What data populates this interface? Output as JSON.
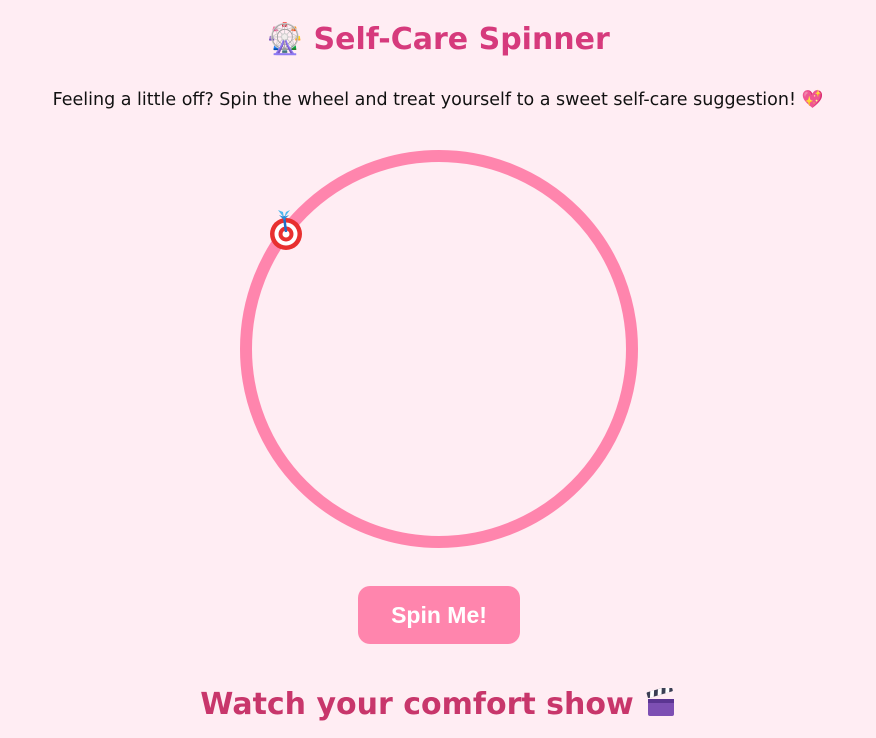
{
  "header": {
    "icon": "ferris-wheel-icon",
    "icon_glyph": "🎡",
    "title": "Self-Care Spinner"
  },
  "intro": {
    "text": "Feeling a little off? Spin the wheel and treat yourself to a sweet self-care suggestion! 💖"
  },
  "wheel": {
    "pointer_icon": "dart-target-icon",
    "ring_color": "#ff85ad"
  },
  "controls": {
    "spin_label": "Spin Me!"
  },
  "suggestion": {
    "text": "Watch your comfort show",
    "icon": "clapperboard-icon"
  },
  "colors": {
    "background": "#ffedf3",
    "title": "#d63a7c",
    "button": "#ff85ad",
    "button_text": "#ffffff",
    "suggestion_text": "#c8366b"
  }
}
